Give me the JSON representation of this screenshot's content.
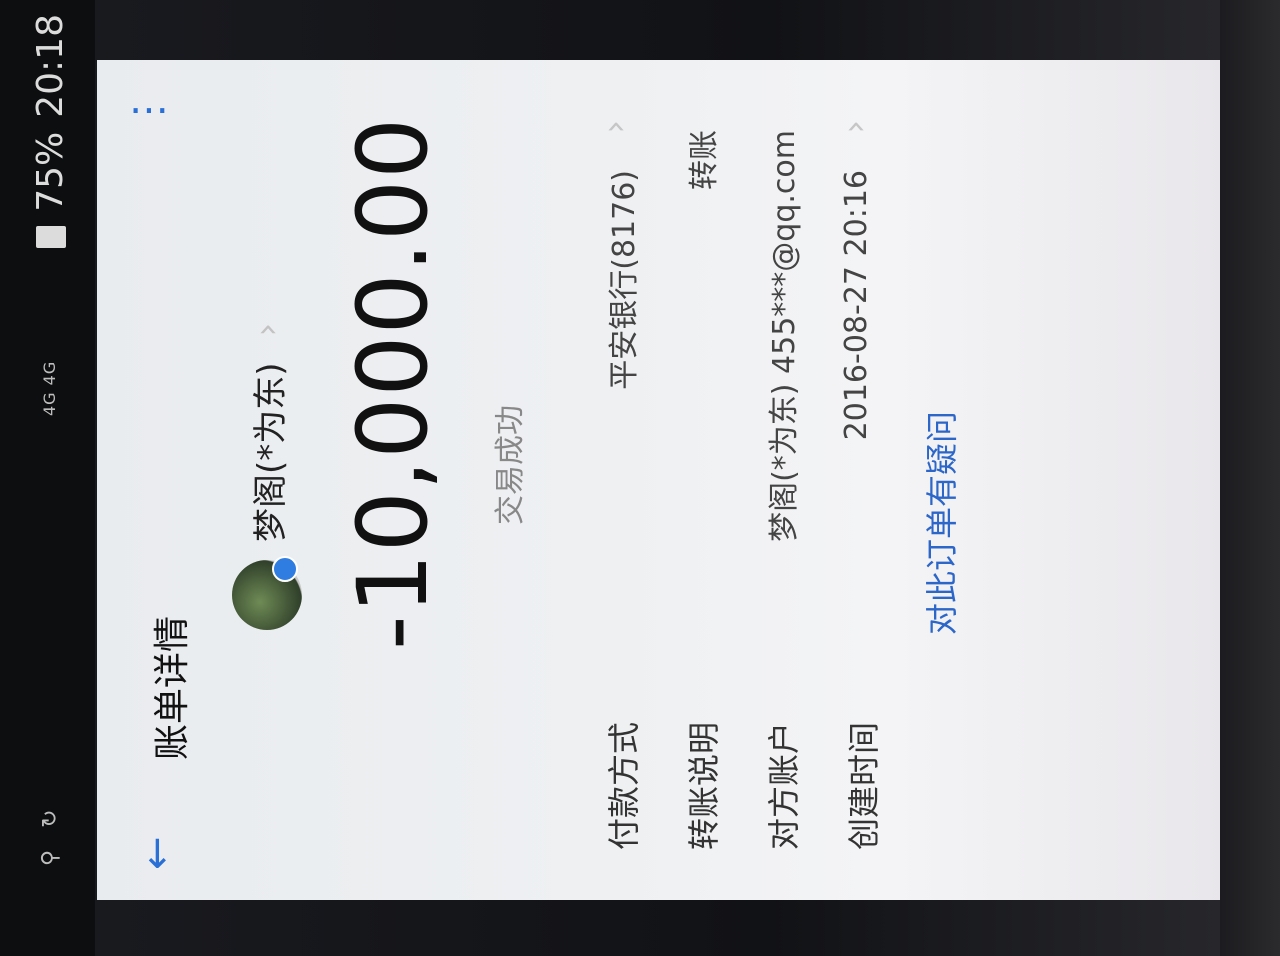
{
  "status_bar": {
    "network": "4G 4G",
    "battery_percent": "75%",
    "time": "20:18"
  },
  "appbar": {
    "title": "账单详情"
  },
  "profile": {
    "name": "梦阁(*为东)"
  },
  "transaction": {
    "amount": "-10,000.00",
    "status": "交易成功"
  },
  "details": [
    {
      "label": "付款方式",
      "value": "平安银行(8176)"
    },
    {
      "label": "转账说明",
      "value": "转账"
    },
    {
      "label": "对方账户",
      "value": "梦阁(*为东) 455***@qq.com"
    },
    {
      "label": "创建时间",
      "value": "2016-08-27 20:16"
    }
  ],
  "help_link": "对此订单有疑问",
  "colors": {
    "accent": "#2a6fd6",
    "link": "#2b66c8"
  },
  "icons": {
    "back": "arrow-left-icon",
    "more": "more-vertical-icon",
    "chevron": "chevron-right-icon"
  }
}
